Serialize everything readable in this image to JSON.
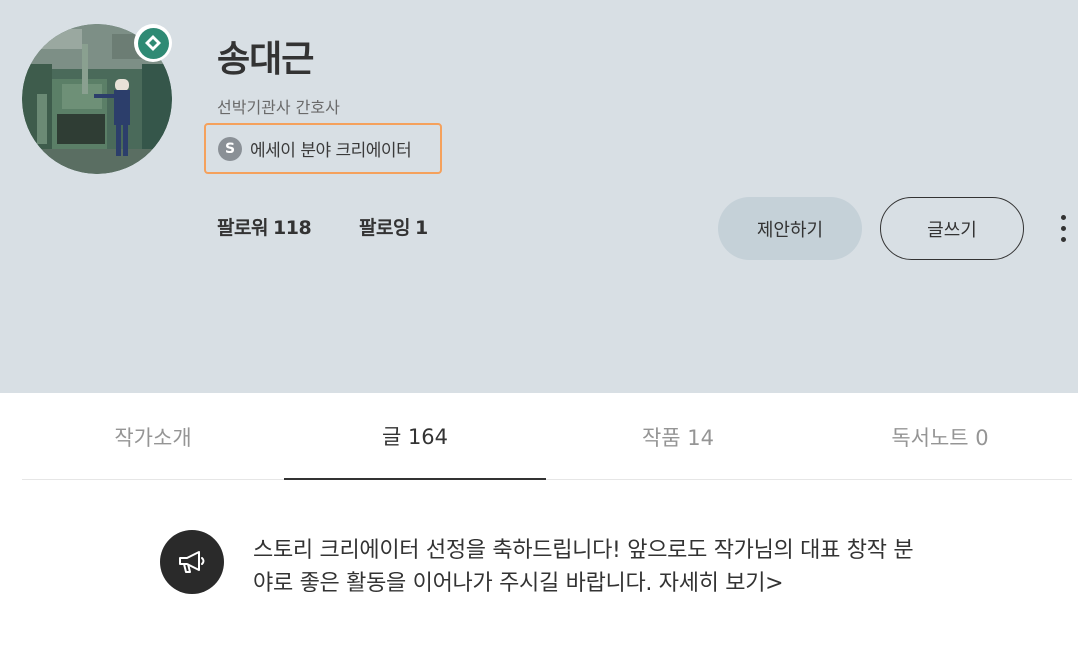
{
  "profile": {
    "name": "송대근",
    "job": "선박기관사 간호사",
    "creator_badge_letter": "S",
    "creator_label": "에세이 분야 크리에이터",
    "avatar_icon": "profile-photo",
    "verified_icon": "verified-diamond-icon"
  },
  "stats": {
    "followers_label": "팔로워",
    "followers_value": "118",
    "following_label": "팔로잉",
    "following_value": "1"
  },
  "actions": {
    "suggest_label": "제안하기",
    "write_label": "글쓰기",
    "more_icon": "more-vertical-icon"
  },
  "tabs": [
    {
      "label": "작가소개",
      "active": false
    },
    {
      "label": "글 164",
      "active": true
    },
    {
      "label": "작품 14",
      "active": false
    },
    {
      "label": "독서노트 0",
      "active": false
    }
  ],
  "notice": {
    "icon": "megaphone-icon",
    "text": "스토리 크리에이터 선정을 축하드립니다! 앞으로도 작가님의 대표 창작 분야로 좋은 활동을 이어나가 주시길 바랍니다. 자세히 보기>"
  },
  "colors": {
    "header_bg": "#d8dfe4",
    "accent_green": "#2f8a74",
    "highlight_orange": "#f5a15c",
    "suggest_bg": "#c5d1d8"
  }
}
